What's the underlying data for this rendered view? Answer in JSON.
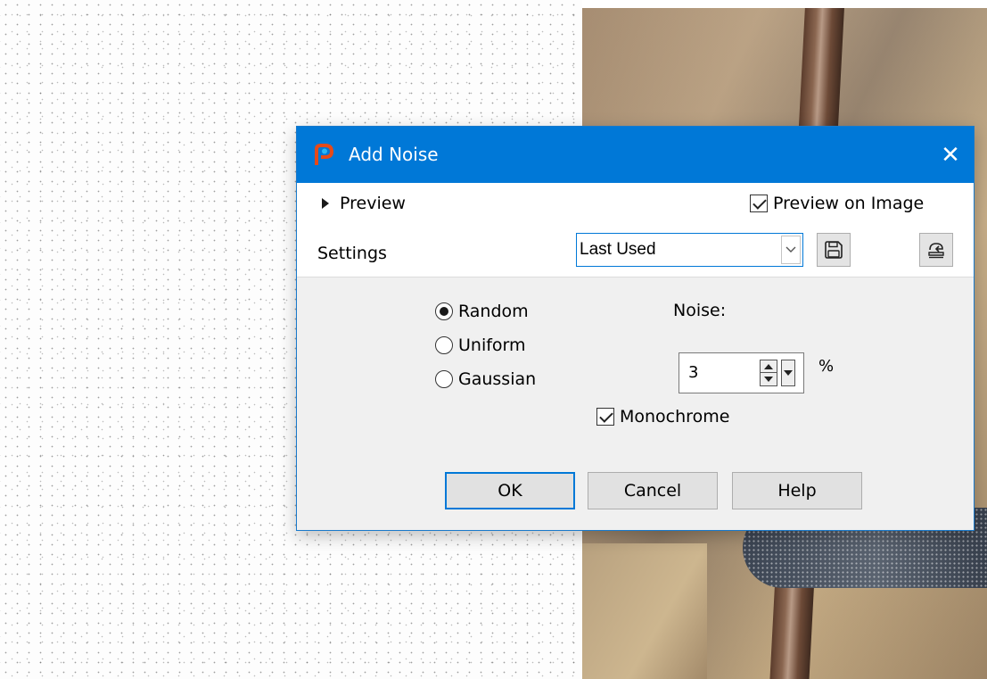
{
  "dialog": {
    "title": "Add Noise",
    "close_glyph": "✕",
    "accent_color": "#0078d7"
  },
  "preview": {
    "toggle_label": "Preview",
    "on_image_label": "Preview on Image",
    "on_image_checked": true
  },
  "settings": {
    "label": "Settings",
    "preset_value": "Last Used"
  },
  "noise_type": {
    "options": [
      "Random",
      "Uniform",
      "Gaussian"
    ],
    "selected": "Random"
  },
  "noise": {
    "label": "Noise:",
    "value": "3",
    "unit": "%"
  },
  "monochrome": {
    "label": "Monochrome",
    "checked": true
  },
  "buttons": {
    "ok": "OK",
    "cancel": "Cancel",
    "help": "Help"
  }
}
